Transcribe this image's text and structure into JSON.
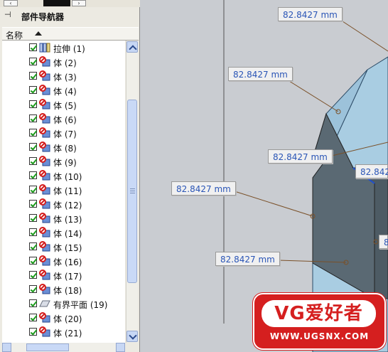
{
  "navigator": {
    "title": "部件导航器",
    "pin_icon": "pin-icon",
    "column_header": "名称",
    "sort_icon": "sort-ascending-icon",
    "items": [
      {
        "label": "拉伸 (1)",
        "icon": "extrude-feature-icon"
      },
      {
        "label": "体 (2)",
        "icon": "body-feature-icon"
      },
      {
        "label": "体 (3)",
        "icon": "body-feature-icon"
      },
      {
        "label": "体 (4)",
        "icon": "body-feature-icon"
      },
      {
        "label": "体 (5)",
        "icon": "body-feature-icon"
      },
      {
        "label": "体 (6)",
        "icon": "body-feature-icon"
      },
      {
        "label": "体 (7)",
        "icon": "body-feature-icon"
      },
      {
        "label": "体 (8)",
        "icon": "body-feature-icon"
      },
      {
        "label": "体 (9)",
        "icon": "body-feature-icon"
      },
      {
        "label": "体 (10)",
        "icon": "body-feature-icon"
      },
      {
        "label": "体 (11)",
        "icon": "body-feature-icon"
      },
      {
        "label": "体 (12)",
        "icon": "body-feature-icon"
      },
      {
        "label": "体 (13)",
        "icon": "body-feature-icon"
      },
      {
        "label": "体 (14)",
        "icon": "body-feature-icon"
      },
      {
        "label": "体 (15)",
        "icon": "body-feature-icon"
      },
      {
        "label": "体 (16)",
        "icon": "body-feature-icon"
      },
      {
        "label": "体 (17)",
        "icon": "body-feature-icon"
      },
      {
        "label": "体 (18)",
        "icon": "body-feature-icon"
      },
      {
        "label": "有界平面 (19)",
        "icon": "bounded-plane-icon"
      },
      {
        "label": "体 (20)",
        "icon": "body-feature-icon"
      },
      {
        "label": "体 (21)",
        "icon": "body-feature-icon"
      }
    ]
  },
  "viewport": {
    "dimensions": [
      {
        "name": "dimension-label-1",
        "text": "82.8427 mm"
      },
      {
        "name": "dimension-label-2",
        "text": "82.8427 mm"
      },
      {
        "name": "dimension-label-3",
        "text": "82.8427 mm"
      },
      {
        "name": "dimension-label-4",
        "text": "82.842"
      },
      {
        "name": "dimension-label-5",
        "text": "82.8427 mm"
      },
      {
        "name": "dimension-label-6",
        "text": "82.8427 mm"
      },
      {
        "name": "dimension-label-7",
        "text": "8"
      }
    ]
  },
  "watermark": {
    "brand": "VG爱好者",
    "url": "WWW.UGSNX.COM"
  },
  "colors": {
    "viewport_background": "#c9ccd1",
    "solid_top": "#a9cde2",
    "solid_side": "#5a6973",
    "dimension_text": "#2a55b6",
    "checkbox_check": "#1c9a1c",
    "watermark_red": "#d51f1f"
  }
}
